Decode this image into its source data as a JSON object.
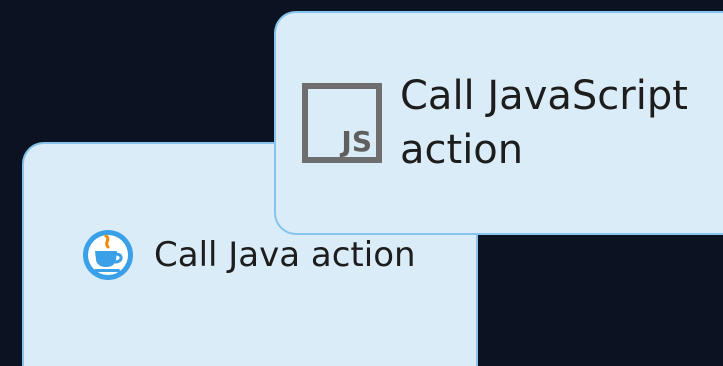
{
  "actions": {
    "java": {
      "label": "Call Java action",
      "icon": "java-cup-icon",
      "icon_color": "#3aa0e8",
      "steam_color": "#f08a00"
    },
    "javascript": {
      "label_line1": "Call JavaScript",
      "label_line2": "action",
      "icon": "javascript-box-icon",
      "icon_text": "JS"
    }
  },
  "colors": {
    "background": "#0b1323",
    "card_fill": "#daecf8",
    "card_border": "#86c4ec"
  }
}
